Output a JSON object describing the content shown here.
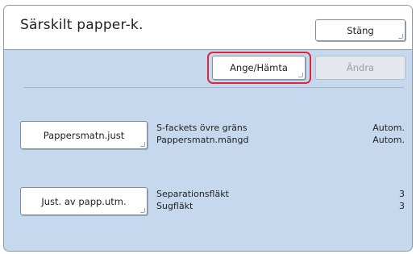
{
  "header": {
    "title": "Särskilt papper-k.",
    "close_label": "Stäng"
  },
  "toolbar": {
    "get_label": "Ange/Hämta",
    "change_label": "Ändra"
  },
  "sections": [
    {
      "button_label": "Pappersmatn.just",
      "rows": [
        {
          "label": "S-fackets övre gräns",
          "value": "Autom."
        },
        {
          "label": "Pappersmatn.mängd",
          "value": "Autom."
        }
      ]
    },
    {
      "button_label": "Just. av papp.utm.",
      "rows": [
        {
          "label": "Separationsfläkt",
          "value": "3"
        },
        {
          "label": "Sugfläkt",
          "value": "3"
        }
      ]
    }
  ],
  "colors": {
    "panel_bg": "#c6d8ee",
    "highlight": "#e0243a"
  }
}
